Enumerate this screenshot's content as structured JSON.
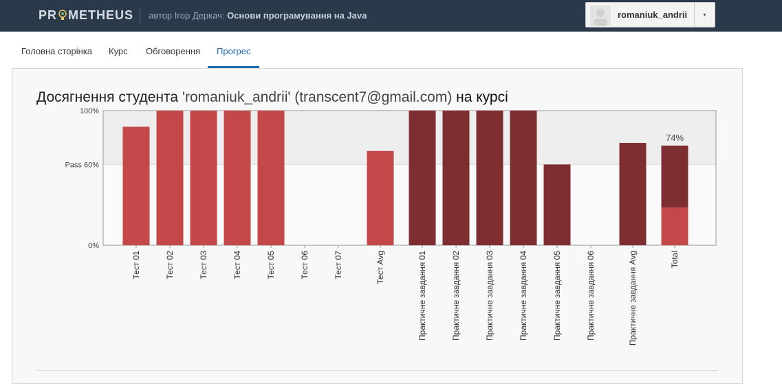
{
  "header": {
    "logo": {
      "before": "PR",
      "after": "METHEUS"
    },
    "author_text": "автор Ігор Деркач:",
    "course_title": "Основи програмування на Java",
    "user_name": "romaniuk_andrii",
    "caret": "▾"
  },
  "tabs": [
    {
      "label": "Головна сторінка"
    },
    {
      "label": "Курс"
    },
    {
      "label": "Обговорення"
    },
    {
      "label": "Прогрес"
    }
  ],
  "progress": {
    "title_prefix": "Досягнення студента",
    "student": "'romaniuk_andrii'",
    "email": "(transcent7@gmail.com)",
    "title_suffix": "на курсі"
  },
  "colors": {
    "header_bg": "#2b3a4a",
    "active_tab": "#1b6fb5",
    "bar_test": "#c4484a",
    "bar_practice": "#7e2d30",
    "pass_band": "#eeeeee"
  },
  "chart_data": {
    "type": "bar",
    "ylim": [
      0,
      100
    ],
    "y_ticks": [
      {
        "value": 100,
        "label": "100%"
      },
      {
        "value": 60,
        "label": "Pass 60%"
      },
      {
        "value": 0,
        "label": "0%"
      }
    ],
    "categories": [
      "Тест 01",
      "Тест 02",
      "Тест 03",
      "Тест 04",
      "Тест 05",
      "Тест 06",
      "Тест 07",
      "Тест Avg",
      "Практичне завдання 01",
      "Практичне завдання 02",
      "Практичне завдання 03",
      "Практичне завдання 04",
      "Практичне завдання 05",
      "Практичне завдання 06",
      "Практичне завдання Avg",
      "Total"
    ],
    "values": [
      88,
      100,
      100,
      100,
      100,
      0,
      0,
      70,
      100,
      100,
      100,
      100,
      60,
      0,
      76,
      74
    ],
    "groups": [
      "test",
      "test",
      "test",
      "test",
      "test",
      "test",
      "test",
      "test",
      "practice",
      "practice",
      "practice",
      "practice",
      "practice",
      "practice",
      "practice",
      "total"
    ],
    "total_breakdown": {
      "test_part": 28,
      "practice_part": 46
    },
    "total_label": "74%",
    "grid": false
  }
}
